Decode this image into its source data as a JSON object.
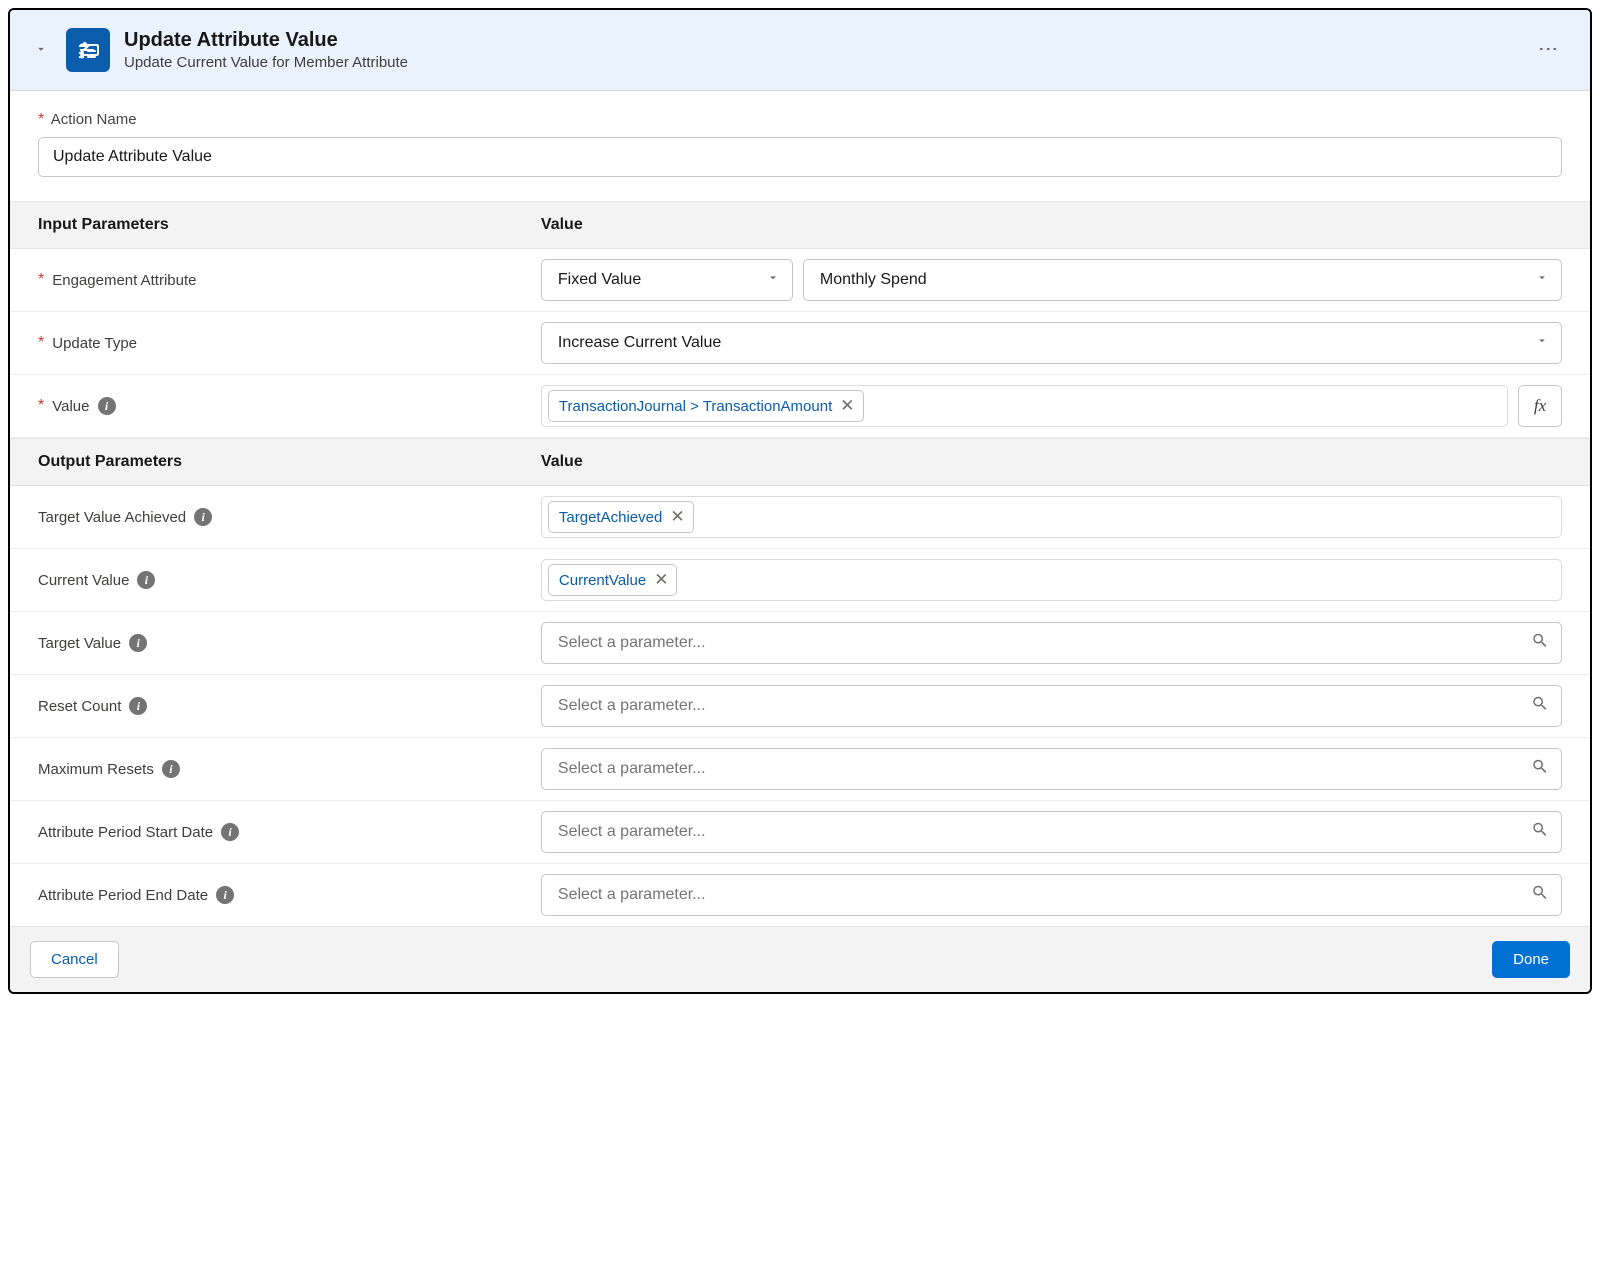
{
  "header": {
    "title": "Update Attribute Value",
    "subtitle": "Update Current Value for Member Attribute"
  },
  "actionName": {
    "label": "Action Name",
    "value": "Update Attribute Value"
  },
  "sections": {
    "input_header_label": "Input Parameters",
    "input_header_value": "Value",
    "output_header_label": "Output Parameters",
    "output_header_value": "Value"
  },
  "input": {
    "engagement": {
      "label": "Engagement Attribute",
      "mode": "Fixed Value",
      "value": "Monthly Spend"
    },
    "updateType": {
      "label": "Update Type",
      "value": "Increase Current Value"
    },
    "value": {
      "label": "Value",
      "token": "TransactionJournal > TransactionAmount"
    }
  },
  "output": {
    "targetAchieved": {
      "label": "Target Value Achieved",
      "token": "TargetAchieved"
    },
    "currentValue": {
      "label": "Current Value",
      "token": "CurrentValue"
    },
    "targetValue": {
      "label": "Target Value",
      "placeholder": "Select a parameter..."
    },
    "resetCount": {
      "label": "Reset Count",
      "placeholder": "Select a parameter..."
    },
    "maxResets": {
      "label": "Maximum Resets",
      "placeholder": "Select a parameter..."
    },
    "periodStart": {
      "label": "Attribute Period Start Date",
      "placeholder": "Select a parameter..."
    },
    "periodEnd": {
      "label": "Attribute Period End Date",
      "placeholder": "Select a parameter..."
    }
  },
  "footer": {
    "cancel": "Cancel",
    "done": "Done"
  }
}
